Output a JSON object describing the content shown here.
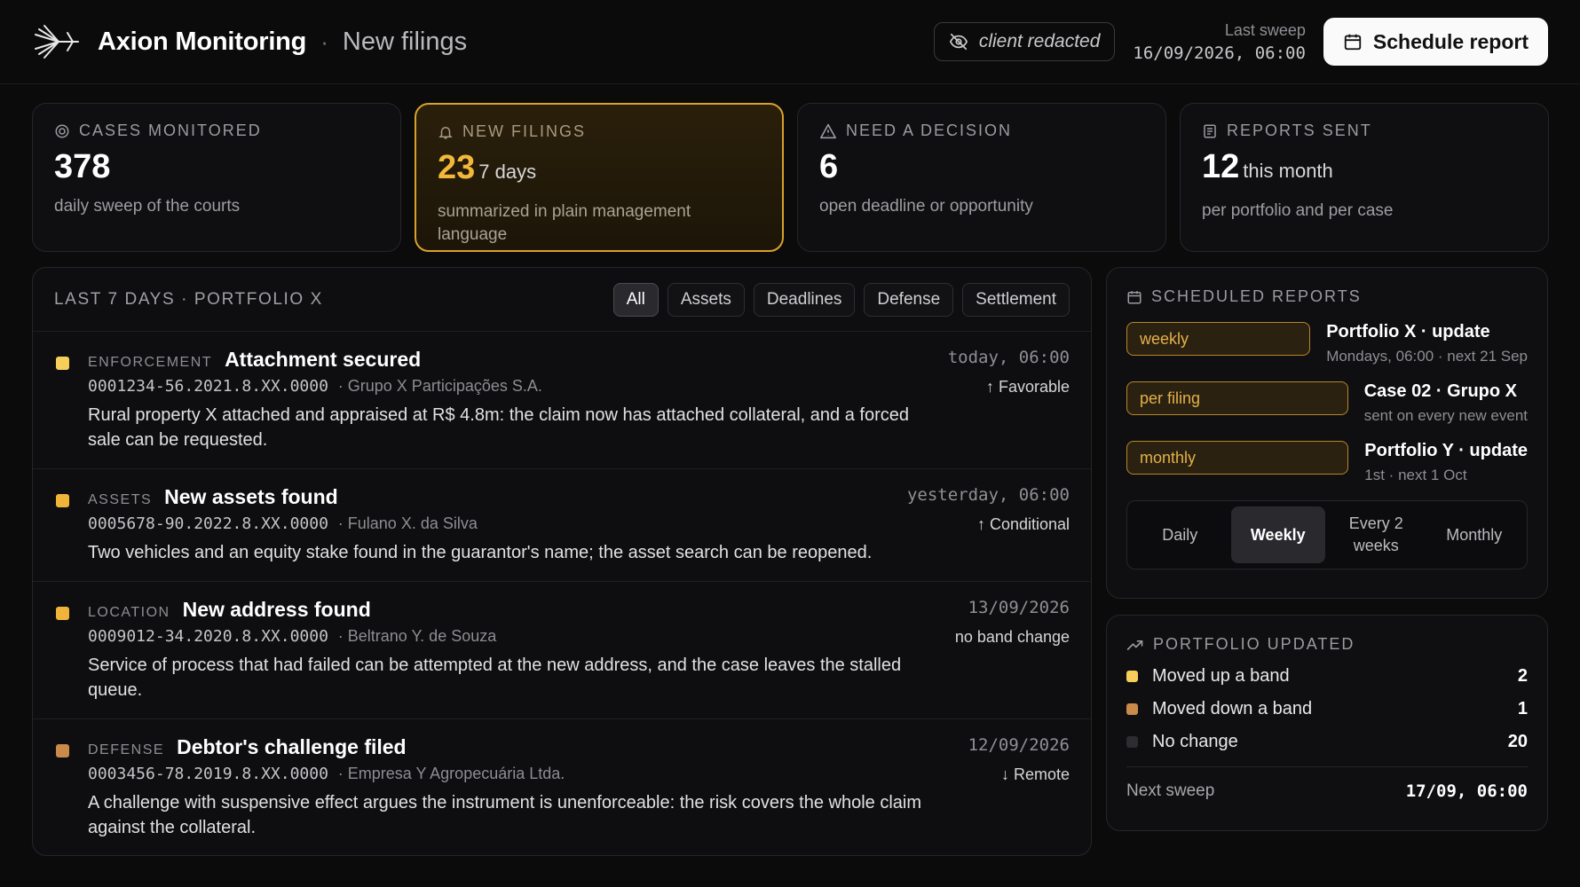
{
  "header": {
    "brand": "Axion Monitoring",
    "separator": "·",
    "subtitle": "New filings",
    "redacted_label": "client redacted",
    "last_sweep_label": "Last sweep",
    "last_sweep_value": "16/09/2026, 06:00",
    "schedule_button": "Schedule report"
  },
  "kpis": [
    {
      "title": "CASES MONITORED",
      "value": "378",
      "unit": "",
      "desc": "daily sweep of the courts",
      "icon": "target-icon"
    },
    {
      "title": "NEW FILINGS",
      "value": "23",
      "unit": "7 days",
      "desc": "summarized in plain management language",
      "icon": "bell-icon"
    },
    {
      "title": "NEED A DECISION",
      "value": "6",
      "unit": "",
      "desc": "open deadline or opportunity",
      "icon": "warning-icon"
    },
    {
      "title": "REPORTS SENT",
      "value": "12",
      "unit": "this month",
      "desc": "per portfolio and per case",
      "icon": "document-icon"
    }
  ],
  "feed": {
    "title": "LAST 7 DAYS · PORTFOLIO X",
    "filters": [
      "All",
      "Assets",
      "Deadlines",
      "Defense",
      "Settlement"
    ],
    "selected_filter": "All",
    "items": [
      {
        "category": "ENFORCEMENT",
        "title": "Attachment secured",
        "ref": "0001234-56.2021.8.XX.0000",
        "party": "· Grupo X Participações S.A.",
        "when": "today, 06:00",
        "status": "↑ Favorable",
        "desc": "Rural property X attached and appraised at R$ 4.8m: the claim now has attached collateral, and a forced sale can be requested.",
        "color": "#f5cf5a"
      },
      {
        "category": "ASSETS",
        "title": "New assets found",
        "ref": "0005678-90.2022.8.XX.0000",
        "party": "· Fulano X. da Silva",
        "when": "yesterday, 06:00",
        "status": "↑ Conditional",
        "desc": "Two vehicles and an equity stake found in the guarantor's name; the asset search can be reopened.",
        "color": "#f0b43a"
      },
      {
        "category": "LOCATION",
        "title": "New address found",
        "ref": "0009012-34.2020.8.XX.0000",
        "party": "· Beltrano Y. de Souza",
        "when": "13/09/2026",
        "status": "no band change",
        "desc": "Service of process that had failed can be attempted at the new address, and the case leaves the stalled queue.",
        "color": "#f0b43a"
      },
      {
        "category": "DEFENSE",
        "title": "Debtor's challenge filed",
        "ref": "0003456-78.2019.8.XX.0000",
        "party": "· Empresa Y Agropecuária Ltda.",
        "when": "12/09/2026",
        "status": "↓ Remote",
        "desc": "A challenge with suspensive effect argues the instrument is unenforceable: the risk covers the whole claim against the collateral.",
        "color": "#c98a4a"
      }
    ]
  },
  "scheduled": {
    "title": "SCHEDULED REPORTS",
    "rows": [
      {
        "tag": "weekly",
        "name": "Portfolio X · update",
        "sub": "Mondays, 06:00 · next 21 Sep"
      },
      {
        "tag": "per filing",
        "name": "Case 02 · Grupo X",
        "sub": "sent on every new event"
      },
      {
        "tag": "monthly",
        "name": "Portfolio Y · update",
        "sub": "1st · next 1 Oct"
      }
    ],
    "frequency": [
      "Daily",
      "Weekly",
      "Every 2 weeks",
      "Monthly"
    ],
    "selected_frequency": "Weekly"
  },
  "portfolio": {
    "title": "PORTFOLIO UPDATED",
    "rows": [
      {
        "label": "Moved up a band",
        "count": "2",
        "color": "#f5cf5a"
      },
      {
        "label": "Moved down a band",
        "count": "1",
        "color": "#c98a4a"
      },
      {
        "label": "No change",
        "count": "20",
        "color": "#2d2d31"
      }
    ],
    "next_sweep_label": "Next sweep",
    "next_sweep_value": "17/09, 06:00"
  }
}
